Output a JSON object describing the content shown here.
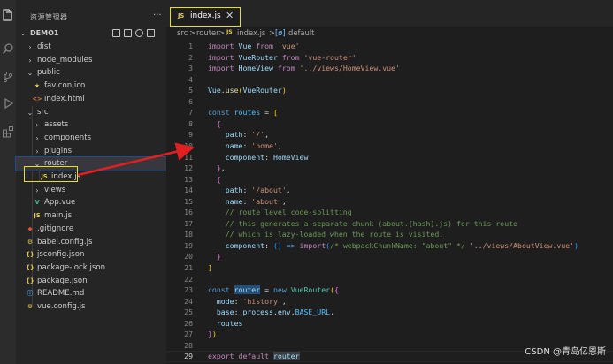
{
  "explorer": {
    "title": "资源管理器",
    "more": "···",
    "project": "DEMO1",
    "items": [
      {
        "label": "dist",
        "kind": "folder",
        "open": false
      },
      {
        "label": "node_modules",
        "kind": "folder",
        "open": false
      },
      {
        "label": "public",
        "kind": "folder",
        "open": true
      },
      {
        "label": "favicon.ico",
        "kind": "ico"
      },
      {
        "label": "index.html",
        "kind": "html"
      },
      {
        "label": "src",
        "kind": "folder",
        "open": true
      },
      {
        "label": "assets",
        "kind": "folder",
        "open": false
      },
      {
        "label": "components",
        "kind": "folder",
        "open": false
      },
      {
        "label": "plugins",
        "kind": "folder",
        "open": false
      },
      {
        "label": "router",
        "kind": "folder",
        "open": true
      },
      {
        "label": "index.js",
        "kind": "js"
      },
      {
        "label": "views",
        "kind": "folder",
        "open": false
      },
      {
        "label": "App.vue",
        "kind": "vue"
      },
      {
        "label": "main.js",
        "kind": "js"
      },
      {
        "label": ".gitignore",
        "kind": "git"
      },
      {
        "label": "babel.config.js",
        "kind": "config"
      },
      {
        "label": "jsconfig.json",
        "kind": "json"
      },
      {
        "label": "package-lock.json",
        "kind": "json"
      },
      {
        "label": "package.json",
        "kind": "json"
      },
      {
        "label": "README.md",
        "kind": "info"
      },
      {
        "label": "vue.config.js",
        "kind": "config"
      }
    ]
  },
  "file_icons": {
    "js": "JS",
    "json": "{}",
    "info": "ⓘ",
    "html": "<>",
    "vue": "V",
    "ico": "★",
    "git": "◆",
    "config": "⚙"
  },
  "colors": {
    "highlight_box": "#e8e21a",
    "arrow": "#e02020",
    "js_icon": "#e6cd4a",
    "vue_icon": "#41b883"
  },
  "editor": {
    "tab": {
      "icon": "JS",
      "label": "index.js",
      "close": "✕"
    },
    "breadcrumb": [
      "src",
      ">",
      "router",
      ">",
      "JS",
      "index.js",
      ">",
      "[ø]",
      "default"
    ],
    "lines": [
      [
        [
          "imp",
          "import"
        ],
        [
          "plain",
          " "
        ],
        [
          "var",
          "Vue"
        ],
        [
          "plain",
          " "
        ],
        [
          "imp",
          "from"
        ],
        [
          "plain",
          " "
        ],
        [
          "str",
          "'vue'"
        ]
      ],
      [
        [
          "imp",
          "import"
        ],
        [
          "plain",
          " "
        ],
        [
          "var",
          "VueRouter"
        ],
        [
          "plain",
          " "
        ],
        [
          "imp",
          "from"
        ],
        [
          "plain",
          " "
        ],
        [
          "str",
          "'vue-router'"
        ]
      ],
      [
        [
          "imp",
          "import"
        ],
        [
          "plain",
          " "
        ],
        [
          "var",
          "HomeView"
        ],
        [
          "plain",
          " "
        ],
        [
          "imp",
          "from"
        ],
        [
          "plain",
          " "
        ],
        [
          "str",
          "'../views/HomeView.vue'"
        ]
      ],
      [],
      [
        [
          "var",
          "Vue"
        ],
        [
          "plain",
          "."
        ],
        [
          "fn",
          "use"
        ],
        [
          "gold",
          "("
        ],
        [
          "var",
          "VueRouter"
        ],
        [
          "gold",
          ")"
        ]
      ],
      [],
      [
        [
          "kw",
          "const"
        ],
        [
          "plain",
          " "
        ],
        [
          "const",
          "routes"
        ],
        [
          "plain",
          " = "
        ],
        [
          "gold",
          "["
        ]
      ],
      [
        [
          "plain",
          "  "
        ],
        [
          "pink",
          "{"
        ]
      ],
      [
        [
          "plain",
          "    "
        ],
        [
          "var",
          "path"
        ],
        [
          "plain",
          ": "
        ],
        [
          "str",
          "'/'"
        ],
        [
          "plain",
          ","
        ]
      ],
      [
        [
          "plain",
          "    "
        ],
        [
          "var",
          "name"
        ],
        [
          "plain",
          ": "
        ],
        [
          "str",
          "'home'"
        ],
        [
          "plain",
          ","
        ]
      ],
      [
        [
          "plain",
          "    "
        ],
        [
          "var",
          "component"
        ],
        [
          "plain",
          ": "
        ],
        [
          "var",
          "HomeView"
        ]
      ],
      [
        [
          "plain",
          "  "
        ],
        [
          "pink",
          "}"
        ],
        [
          "plain",
          ","
        ]
      ],
      [
        [
          "plain",
          "  "
        ],
        [
          "pink",
          "{"
        ]
      ],
      [
        [
          "plain",
          "    "
        ],
        [
          "var",
          "path"
        ],
        [
          "plain",
          ": "
        ],
        [
          "str",
          "'/about'"
        ],
        [
          "plain",
          ","
        ]
      ],
      [
        [
          "plain",
          "    "
        ],
        [
          "var",
          "name"
        ],
        [
          "plain",
          ": "
        ],
        [
          "str",
          "'about'"
        ],
        [
          "plain",
          ","
        ]
      ],
      [
        [
          "plain",
          "    "
        ],
        [
          "com",
          "// route level code-splitting"
        ]
      ],
      [
        [
          "plain",
          "    "
        ],
        [
          "com",
          "// this generates a separate chunk (about.[hash].js) for this route"
        ]
      ],
      [
        [
          "plain",
          "    "
        ],
        [
          "com",
          "// which is lazy-loaded when the route is visited."
        ]
      ],
      [
        [
          "plain",
          "    "
        ],
        [
          "var",
          "component"
        ],
        [
          "plain",
          ": "
        ],
        [
          "blue",
          "()"
        ],
        [
          "plain",
          " "
        ],
        [
          "kw",
          "=>"
        ],
        [
          "plain",
          " "
        ],
        [
          "imp",
          "import"
        ],
        [
          "blue",
          "("
        ],
        [
          "com",
          "/* webpackChunkName: \"about\" */"
        ],
        [
          "plain",
          " "
        ],
        [
          "str",
          "'../views/AboutView.vue'"
        ],
        [
          "blue",
          ")"
        ]
      ],
      [
        [
          "plain",
          "  "
        ],
        [
          "pink",
          "}"
        ]
      ],
      [
        [
          "gold",
          "]"
        ]
      ],
      [],
      [
        [
          "kw",
          "const"
        ],
        [
          "plain",
          " "
        ],
        [
          "hl",
          "router"
        ],
        [
          "plain",
          " = "
        ],
        [
          "kw",
          "new"
        ],
        [
          "plain",
          " "
        ],
        [
          "cls",
          "VueRouter"
        ],
        [
          "gold",
          "("
        ],
        [
          "pink",
          "{"
        ]
      ],
      [
        [
          "plain",
          "  "
        ],
        [
          "var",
          "mode"
        ],
        [
          "plain",
          ": "
        ],
        [
          "str",
          "'history'"
        ],
        [
          "plain",
          ","
        ]
      ],
      [
        [
          "plain",
          "  "
        ],
        [
          "var",
          "base"
        ],
        [
          "plain",
          ": "
        ],
        [
          "var",
          "process"
        ],
        [
          "plain",
          "."
        ],
        [
          "var",
          "env"
        ],
        [
          "plain",
          "."
        ],
        [
          "const",
          "BASE_URL"
        ],
        [
          "plain",
          ","
        ]
      ],
      [
        [
          "plain",
          "  "
        ],
        [
          "var",
          "routes"
        ]
      ],
      [
        [
          "pink",
          "}"
        ],
        [
          "gold",
          ")"
        ]
      ],
      [],
      [
        [
          "imp",
          "export"
        ],
        [
          "plain",
          " "
        ],
        [
          "imp",
          "default"
        ],
        [
          "plain",
          " "
        ],
        [
          "hl2",
          "router"
        ]
      ]
    ],
    "current_line": 29
  },
  "watermark": "CSDN @青岛亿恩斯"
}
